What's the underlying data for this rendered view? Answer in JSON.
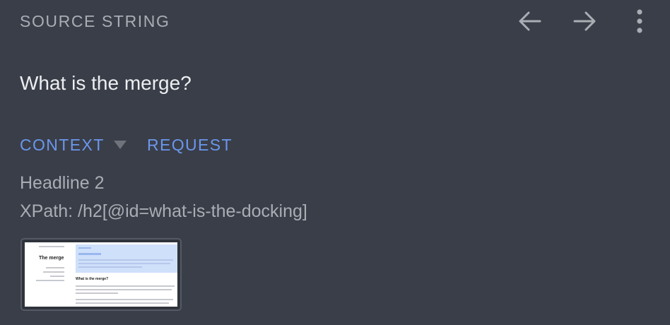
{
  "header": {
    "section_label": "SOURCE STRING",
    "back_icon": "arrow-left-icon",
    "forward_icon": "arrow-right-icon",
    "more_icon": "more-vertical-icon"
  },
  "source_string": "What is the merge?",
  "tabs": [
    {
      "label": "CONTEXT",
      "has_dropdown": true
    },
    {
      "label": "REQUEST",
      "has_dropdown": false
    }
  ],
  "context": {
    "type": "Headline 2",
    "xpath": "XPath: /h2[@id=what-is-the-docking]"
  },
  "screenshot_thumbnail": {
    "page_title": "The merge",
    "heading": "What is the merge?"
  },
  "colors": {
    "background": "#3a3e48",
    "accent": "#6b97ee",
    "muted_text": "#a9adb4",
    "primary_text": "#eceef1"
  }
}
